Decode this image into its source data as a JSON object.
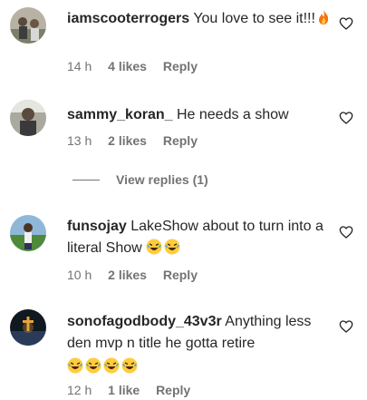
{
  "comments": [
    {
      "username": "iamscooterrogers",
      "text": "You love to see it!!!",
      "emoji": [
        "fire"
      ],
      "time": "14 h",
      "likes": "4 likes",
      "reply": "Reply"
    },
    {
      "username": "sammy_koran_",
      "text": "He needs a show",
      "emoji": [],
      "time": "13 h",
      "likes": "2 likes",
      "reply": "Reply"
    },
    {
      "username": "funsojay",
      "text": "LakeShow about to turn into a literal Show",
      "emoji": [
        "laughing",
        "laughing"
      ],
      "time": "10 h",
      "likes": "2 likes",
      "reply": "Reply"
    },
    {
      "username": "sonofagodbody_43v3r",
      "text": "Anything less den mvp n title he gotta retire",
      "emoji": [
        "laughing",
        "laughing",
        "laughing",
        "laughing"
      ],
      "time": "12 h",
      "likes": "1 like",
      "reply": "Reply"
    }
  ],
  "view_replies": "View replies (1)",
  "colors": {
    "text": "#262626",
    "muted": "#737373"
  }
}
